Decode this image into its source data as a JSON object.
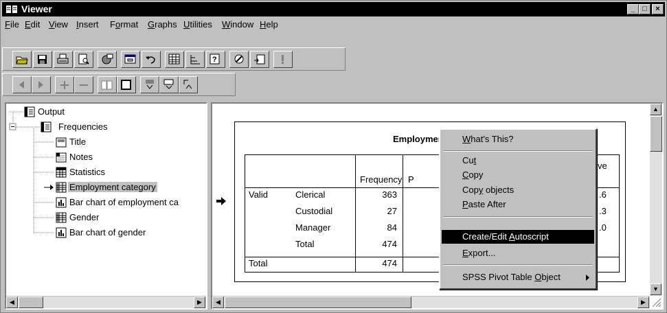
{
  "window": {
    "title": "Viewer"
  },
  "caption_buttons": {
    "minimize": "_",
    "maximize": "□",
    "close": "×"
  },
  "menu": [
    {
      "pre": "",
      "acc": "F",
      "post": "ile"
    },
    {
      "pre": "",
      "acc": "E",
      "post": "dit"
    },
    {
      "pre": "",
      "acc": "V",
      "post": "iew"
    },
    {
      "pre": "",
      "acc": "I",
      "post": "nsert"
    },
    {
      "pre": "F",
      "acc": "o",
      "post": "rmat"
    },
    {
      "pre": "",
      "acc": "G",
      "post": "raphs"
    },
    {
      "pre": "",
      "acc": "U",
      "post": "tilities"
    },
    {
      "pre": "",
      "acc": "W",
      "post": "indow"
    },
    {
      "pre": "",
      "acc": "H",
      "post": "elp"
    }
  ],
  "outline": {
    "items": [
      {
        "label": "Output",
        "icon": "output-book-icon"
      },
      {
        "label": "Frequencies",
        "icon": "procedure-book-icon"
      },
      {
        "label": "Title",
        "icon": "title-icon"
      },
      {
        "label": "Notes",
        "icon": "notes-icon"
      },
      {
        "label": "Statistics",
        "icon": "statistics-table-icon"
      },
      {
        "label": "Employment category",
        "icon": "pivot-table-icon",
        "selected": true
      },
      {
        "label": "Bar chart of employment ca",
        "icon": "bar-chart-icon"
      },
      {
        "label": "Gender",
        "icon": "pivot-table-icon"
      },
      {
        "label": "Bar chart of gender",
        "icon": "bar-chart-icon"
      }
    ]
  },
  "pivot": {
    "title": "Employment c",
    "col_frequency": "Frequency",
    "col_percent": "P",
    "col_cumulative_tail": "ve",
    "row_valid": "Valid",
    "row_total": "Total",
    "categories": [
      "Clerical",
      "Custodial",
      "Manager",
      "Total"
    ],
    "frequencies": [
      "363",
      "27",
      "84",
      "474"
    ],
    "total_frequency": "474",
    "cumulative_tail": [
      ".6",
      ".3",
      ".0"
    ]
  },
  "context_menu": {
    "whats_this": {
      "pre": "",
      "acc": "W",
      "post": "hat's This?"
    },
    "cut": {
      "pre": "Cu",
      "acc": "t",
      "post": ""
    },
    "copy": {
      "pre": "",
      "acc": "C",
      "post": "opy"
    },
    "copy_objects": {
      "pre": "Cop",
      "acc": "y",
      "post": " objects"
    },
    "paste_after": {
      "pre": "",
      "acc": "P",
      "post": "aste After"
    },
    "create_edit_autoscript": {
      "pre": "Create/Edit ",
      "acc": "A",
      "post": "utoscript"
    },
    "export": {
      "pre": "",
      "acc": "E",
      "post": "xport..."
    },
    "pivot_table_object": {
      "pre": "SPSS Pivot Table ",
      "acc": "O",
      "post": "bject"
    }
  }
}
